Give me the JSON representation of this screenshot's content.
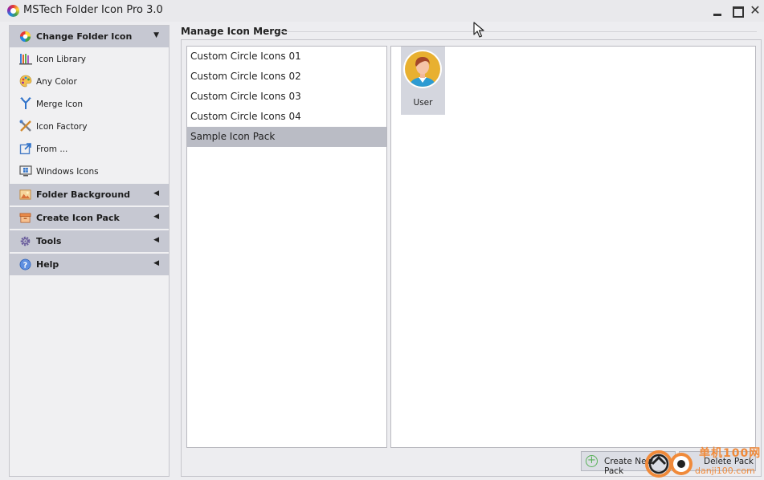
{
  "window": {
    "title": "MSTech Folder Icon Pro 3.0",
    "close_glyph": "✕"
  },
  "sidebar": {
    "groups": [
      {
        "label": "Change Folder Icon",
        "icon": "color-wheel-icon",
        "expanded": true,
        "items": [
          {
            "label": "Icon Library",
            "icon": "library-icon"
          },
          {
            "label": "Any Color",
            "icon": "palette-icon"
          },
          {
            "label": "Merge Icon",
            "icon": "merge-icon"
          },
          {
            "label": "Icon Factory",
            "icon": "tools-icon"
          },
          {
            "label": "From ...",
            "icon": "external-link-icon"
          },
          {
            "label": "Windows Icons",
            "icon": "windows-monitor-icon"
          }
        ]
      },
      {
        "label": "Folder Background",
        "icon": "picture-icon",
        "expanded": false
      },
      {
        "label": "Create Icon Pack",
        "icon": "box-icon",
        "expanded": false
      },
      {
        "label": "Tools",
        "icon": "gear-icon",
        "expanded": false
      },
      {
        "label": "Help",
        "icon": "help-icon",
        "expanded": false
      }
    ]
  },
  "main": {
    "section_title": "Manage Icon Merge",
    "packs": [
      {
        "label": "Custom Circle Icons 01",
        "selected": false
      },
      {
        "label": "Custom Circle Icons 02",
        "selected": false
      },
      {
        "label": "Custom Circle Icons 03",
        "selected": false
      },
      {
        "label": "Custom Circle Icons 04",
        "selected": false
      },
      {
        "label": "Sample Icon Pack",
        "selected": true
      }
    ],
    "icons": [
      {
        "label": "User",
        "icon": "user-avatar-icon"
      }
    ],
    "buttons": {
      "create": "Create New Pack",
      "delete": "Delete Pack"
    }
  },
  "watermark": {
    "line1": "单机100网",
    "line2": "danji100.com"
  },
  "colors": {
    "header_bg": "#c6c8d2",
    "selected_bg": "#babcc5",
    "accent_orange": "#f08a3a"
  }
}
